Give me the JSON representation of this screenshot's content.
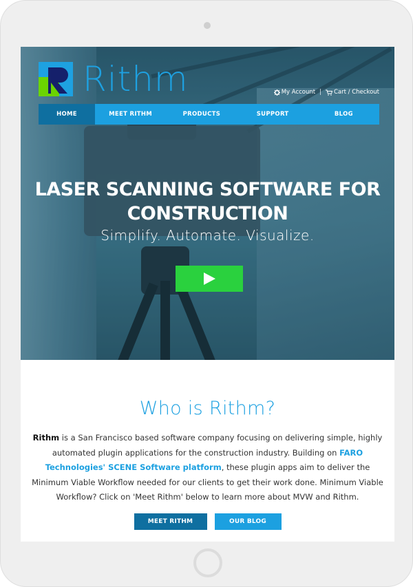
{
  "header": {
    "brand": "Rithm",
    "account_label": "My Account",
    "divider": "|",
    "cart_label": "Cart / Checkout"
  },
  "nav": {
    "items": [
      "HOME",
      "MEET RITHM",
      "PRODUCTS",
      "SUPPORT",
      "BLOG"
    ],
    "active": "HOME"
  },
  "hero": {
    "title_line1": "LASER SCANNING SOFTWARE FOR",
    "title_line2": "CONSTRUCTION",
    "subtitle": "Simplify. Automate. Visualize."
  },
  "about": {
    "title": "Who is Rithm?",
    "brand_word": "Rithm",
    "text_part1": " is a San Francisco based software company focusing on delivering simple, highly automated plugin applications for the construction industry. Building on ",
    "link_text": "FARO Technologies' SCENE Software platform",
    "text_part2": ", these plugin apps aim to deliver the Minimum Viable Workflow needed for our clients to get their work done. Minimum Viable Workflow? Click on 'Meet Rithm' below to learn more about MVW and Rithm.",
    "button_meet": "MEET RITHM",
    "button_blog": "OUR BLOG"
  },
  "colors": {
    "brand_blue": "#1ca0e0",
    "nav_active": "#0f6fa0",
    "play_green": "#2ad13e"
  },
  "icons": [
    "gear-icon",
    "cart-icon",
    "play-icon",
    "logo-mark-icon",
    "camera-icon",
    "home-button-icon"
  ]
}
